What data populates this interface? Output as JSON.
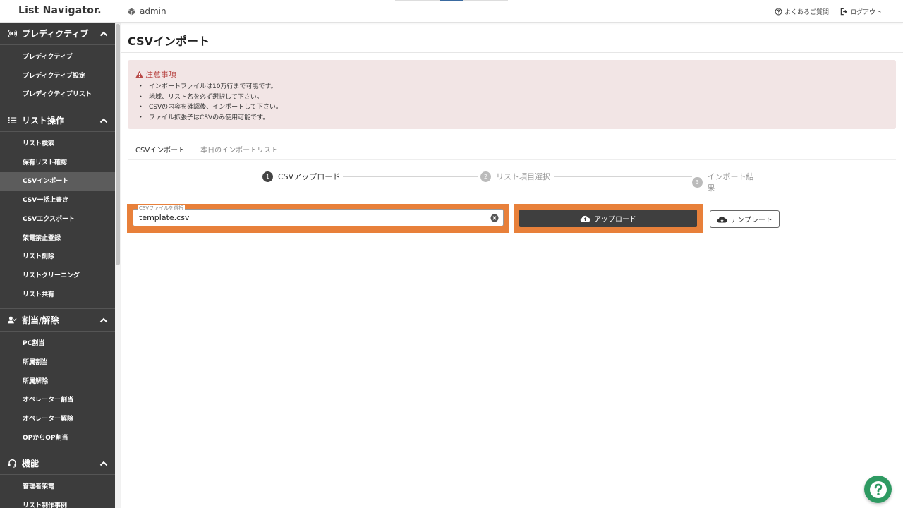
{
  "header": {
    "logo": "List Navigator.",
    "user": "admin",
    "faq_label": "よくあるご質問",
    "logout_label": "ログアウト"
  },
  "sidebar": {
    "sections": [
      {
        "title": "プレディクティブ",
        "icon": "broadcast-icon",
        "items": [
          "プレディクティブ",
          "プレディクティブ設定",
          "プレディクティブリスト"
        ]
      },
      {
        "title": "リスト操作",
        "icon": "list-icon",
        "items": [
          "リスト検索",
          "保有リスト確認",
          "CSVインポート",
          "CSV一括上書き",
          "CSVエクスポート",
          "架電禁止登録",
          "リスト削除",
          "リストクリーニング",
          "リスト共有"
        ]
      },
      {
        "title": "割当/解除",
        "icon": "user-check-icon",
        "items": [
          "PC割当",
          "所属割当",
          "所属解除",
          "オペレーター割当",
          "オペレーター解除",
          "OPからOP割当"
        ]
      },
      {
        "title": "機能",
        "icon": "headset-icon",
        "items": [
          "管理者架電",
          "リスト制作事例"
        ]
      }
    ],
    "active_item": "CSVインポート"
  },
  "main": {
    "page_title": "CSVインポート",
    "notice": {
      "title": "注意事項",
      "items": [
        "インポートファイルは10万行まで可能です。",
        "地域、リスト名を必ず選択して下さい。",
        "CSVの内容を確認後、インポートして下さい。",
        "ファイル拡張子はCSVのみ使用可能です。"
      ]
    },
    "tabs": [
      "CSVインポート",
      "本日のインポートリスト"
    ],
    "active_tab": 0,
    "steps": [
      {
        "num": "1",
        "label": "CSVアップロード"
      },
      {
        "num": "2",
        "label": "リスト項目選択"
      },
      {
        "num": "3",
        "label": "インポート結果"
      }
    ],
    "file_input": {
      "legend": "CSVファイルを選択",
      "value": "template.csv"
    },
    "upload_label": "アップロード",
    "template_label": "テンプレート"
  },
  "colors": {
    "sidebar_bg": "#3c3c3c",
    "highlight": "#e8803a",
    "notice_bg": "#f2e5e5",
    "notice_title": "#b94a48",
    "help_fab": "#2e9a62"
  }
}
